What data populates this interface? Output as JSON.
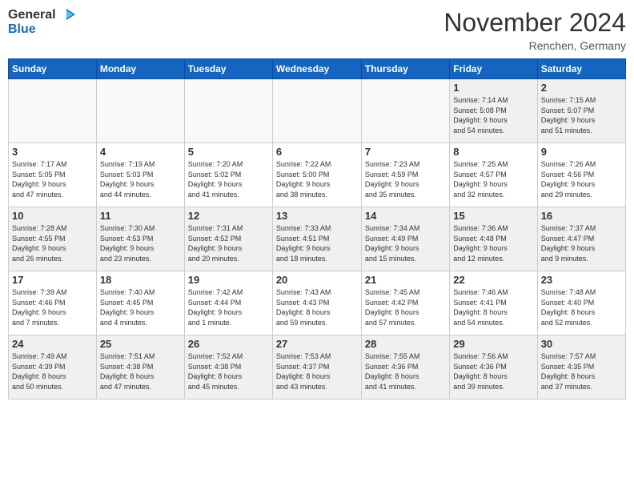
{
  "header": {
    "logo_general": "General",
    "logo_blue": "Blue",
    "month_title": "November 2024",
    "location": "Renchen, Germany"
  },
  "days_of_week": [
    "Sunday",
    "Monday",
    "Tuesday",
    "Wednesday",
    "Thursday",
    "Friday",
    "Saturday"
  ],
  "weeks": [
    [
      {
        "day": "",
        "info": ""
      },
      {
        "day": "",
        "info": ""
      },
      {
        "day": "",
        "info": ""
      },
      {
        "day": "",
        "info": ""
      },
      {
        "day": "",
        "info": ""
      },
      {
        "day": "1",
        "info": "Sunrise: 7:14 AM\nSunset: 5:08 PM\nDaylight: 9 hours\nand 54 minutes."
      },
      {
        "day": "2",
        "info": "Sunrise: 7:15 AM\nSunset: 5:07 PM\nDaylight: 9 hours\nand 51 minutes."
      }
    ],
    [
      {
        "day": "3",
        "info": "Sunrise: 7:17 AM\nSunset: 5:05 PM\nDaylight: 9 hours\nand 47 minutes."
      },
      {
        "day": "4",
        "info": "Sunrise: 7:19 AM\nSunset: 5:03 PM\nDaylight: 9 hours\nand 44 minutes."
      },
      {
        "day": "5",
        "info": "Sunrise: 7:20 AM\nSunset: 5:02 PM\nDaylight: 9 hours\nand 41 minutes."
      },
      {
        "day": "6",
        "info": "Sunrise: 7:22 AM\nSunset: 5:00 PM\nDaylight: 9 hours\nand 38 minutes."
      },
      {
        "day": "7",
        "info": "Sunrise: 7:23 AM\nSunset: 4:59 PM\nDaylight: 9 hours\nand 35 minutes."
      },
      {
        "day": "8",
        "info": "Sunrise: 7:25 AM\nSunset: 4:57 PM\nDaylight: 9 hours\nand 32 minutes."
      },
      {
        "day": "9",
        "info": "Sunrise: 7:26 AM\nSunset: 4:56 PM\nDaylight: 9 hours\nand 29 minutes."
      }
    ],
    [
      {
        "day": "10",
        "info": "Sunrise: 7:28 AM\nSunset: 4:55 PM\nDaylight: 9 hours\nand 26 minutes."
      },
      {
        "day": "11",
        "info": "Sunrise: 7:30 AM\nSunset: 4:53 PM\nDaylight: 9 hours\nand 23 minutes."
      },
      {
        "day": "12",
        "info": "Sunrise: 7:31 AM\nSunset: 4:52 PM\nDaylight: 9 hours\nand 20 minutes."
      },
      {
        "day": "13",
        "info": "Sunrise: 7:33 AM\nSunset: 4:51 PM\nDaylight: 9 hours\nand 18 minutes."
      },
      {
        "day": "14",
        "info": "Sunrise: 7:34 AM\nSunset: 4:49 PM\nDaylight: 9 hours\nand 15 minutes."
      },
      {
        "day": "15",
        "info": "Sunrise: 7:36 AM\nSunset: 4:48 PM\nDaylight: 9 hours\nand 12 minutes."
      },
      {
        "day": "16",
        "info": "Sunrise: 7:37 AM\nSunset: 4:47 PM\nDaylight: 9 hours\nand 9 minutes."
      }
    ],
    [
      {
        "day": "17",
        "info": "Sunrise: 7:39 AM\nSunset: 4:46 PM\nDaylight: 9 hours\nand 7 minutes."
      },
      {
        "day": "18",
        "info": "Sunrise: 7:40 AM\nSunset: 4:45 PM\nDaylight: 9 hours\nand 4 minutes."
      },
      {
        "day": "19",
        "info": "Sunrise: 7:42 AM\nSunset: 4:44 PM\nDaylight: 9 hours\nand 1 minute."
      },
      {
        "day": "20",
        "info": "Sunrise: 7:43 AM\nSunset: 4:43 PM\nDaylight: 8 hours\nand 59 minutes."
      },
      {
        "day": "21",
        "info": "Sunrise: 7:45 AM\nSunset: 4:42 PM\nDaylight: 8 hours\nand 57 minutes."
      },
      {
        "day": "22",
        "info": "Sunrise: 7:46 AM\nSunset: 4:41 PM\nDaylight: 8 hours\nand 54 minutes."
      },
      {
        "day": "23",
        "info": "Sunrise: 7:48 AM\nSunset: 4:40 PM\nDaylight: 8 hours\nand 52 minutes."
      }
    ],
    [
      {
        "day": "24",
        "info": "Sunrise: 7:49 AM\nSunset: 4:39 PM\nDaylight: 8 hours\nand 50 minutes."
      },
      {
        "day": "25",
        "info": "Sunrise: 7:51 AM\nSunset: 4:38 PM\nDaylight: 8 hours\nand 47 minutes."
      },
      {
        "day": "26",
        "info": "Sunrise: 7:52 AM\nSunset: 4:38 PM\nDaylight: 8 hours\nand 45 minutes."
      },
      {
        "day": "27",
        "info": "Sunrise: 7:53 AM\nSunset: 4:37 PM\nDaylight: 8 hours\nand 43 minutes."
      },
      {
        "day": "28",
        "info": "Sunrise: 7:55 AM\nSunset: 4:36 PM\nDaylight: 8 hours\nand 41 minutes."
      },
      {
        "day": "29",
        "info": "Sunrise: 7:56 AM\nSunset: 4:36 PM\nDaylight: 8 hours\nand 39 minutes."
      },
      {
        "day": "30",
        "info": "Sunrise: 7:57 AM\nSunset: 4:35 PM\nDaylight: 8 hours\nand 37 minutes."
      }
    ]
  ]
}
